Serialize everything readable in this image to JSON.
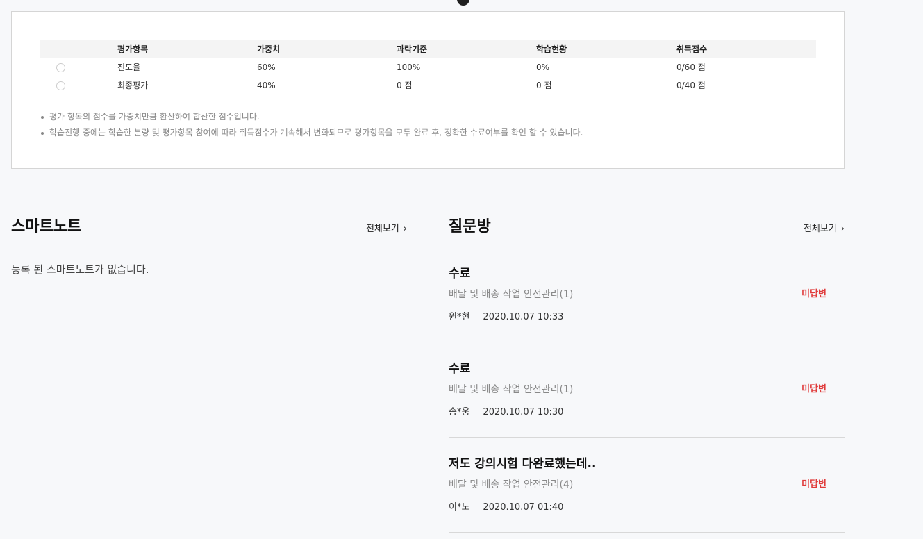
{
  "eval": {
    "headers": [
      "평가항목",
      "가중치",
      "과락기준",
      "학습현황",
      "취득점수"
    ],
    "rows": [
      {
        "item": "진도율",
        "weight": "60%",
        "cutoff": "100%",
        "progress": "0%",
        "score": "0/60 점"
      },
      {
        "item": "최종평가",
        "weight": "40%",
        "cutoff": "0 점",
        "progress": "0 점",
        "score": "0/40 점"
      }
    ],
    "notes": [
      "평가 항목의 점수를 가중치만큼 환산하여 합산한 점수입니다.",
      "학습진행 중에는 학습한 분량 및 평가항목 참여에 따라 취득점수가 계속해서 변화되므로 평가항목을 모두 완료 후, 정확한 수료여부를 확인 할 수 있습니다."
    ]
  },
  "smartnote": {
    "title": "스마트노트",
    "view_all": "전체보기",
    "empty": "등록 된 스마트노트가 없습니다."
  },
  "qna": {
    "title": "질문방",
    "view_all": "전체보기",
    "items": [
      {
        "title": "수료",
        "course": "배달 및 배송 작업 안전관리(1)",
        "status": "미답변",
        "author": "원*현",
        "date": "2020.10.07 10:33"
      },
      {
        "title": "수료",
        "course": "배달 및 배송 작업 안전관리(1)",
        "status": "미답변",
        "author": "송*웅",
        "date": "2020.10.07 10:30"
      },
      {
        "title": "저도 강의시험 다완료했는데..",
        "course": "배달 및 배송 작업 안전관리(4)",
        "status": "미답변",
        "author": "이*노",
        "date": "2020.10.07 01:40"
      }
    ]
  },
  "colors": {
    "accent_status": "#e03a3a"
  }
}
